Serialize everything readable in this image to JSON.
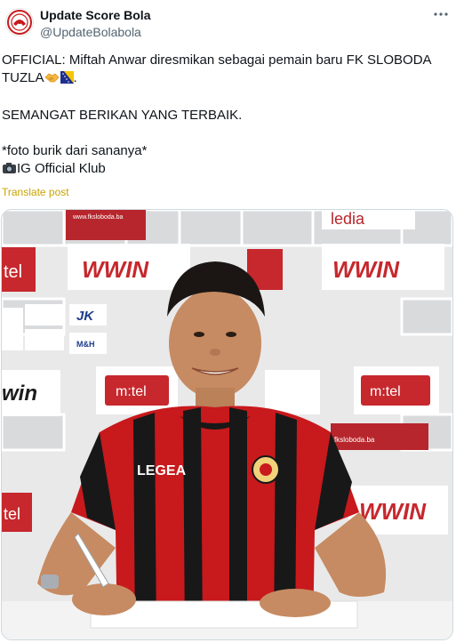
{
  "author": {
    "name": "Update Score Bola",
    "handle": "@UpdateBolabola",
    "avatar_icon": "club-crest-icon"
  },
  "menu_icon": "more-options-icon",
  "tweet": {
    "line1": "OFFICIAL: Miftah Anwar diresmikan sebagai pemain baru FK SLOBODA",
    "line2": "TUZLA",
    "line3": "SEMANGAT BERIKAN YANG TERBAIK.",
    "line4": "*foto burik dari sananya*",
    "line5": "IG Official Klub",
    "emoji_handshake": "handshake-emoji",
    "emoji_flag": "bosnia-flag-emoji",
    "emoji_camera": "camera-emoji"
  },
  "translate_label": "Translate post",
  "photo": {
    "boards": {
      "brand_wwin": "WWIN",
      "brand_mtel": "m:tel",
      "brand_tel": "tel",
      "brand_win": "win",
      "brand_jk": "JK",
      "brand_mh": "M&H",
      "brand_ledia": "ledia",
      "site_url": "www.fksloboda.ba",
      "site_url_short": "fksloboda.ba"
    },
    "jersey_brand": "LEGEA",
    "colors": {
      "jersey_red": "#c8191c",
      "jersey_black": "#181818",
      "board_red": "#b7262c",
      "table_white": "#f3f3f3"
    }
  }
}
